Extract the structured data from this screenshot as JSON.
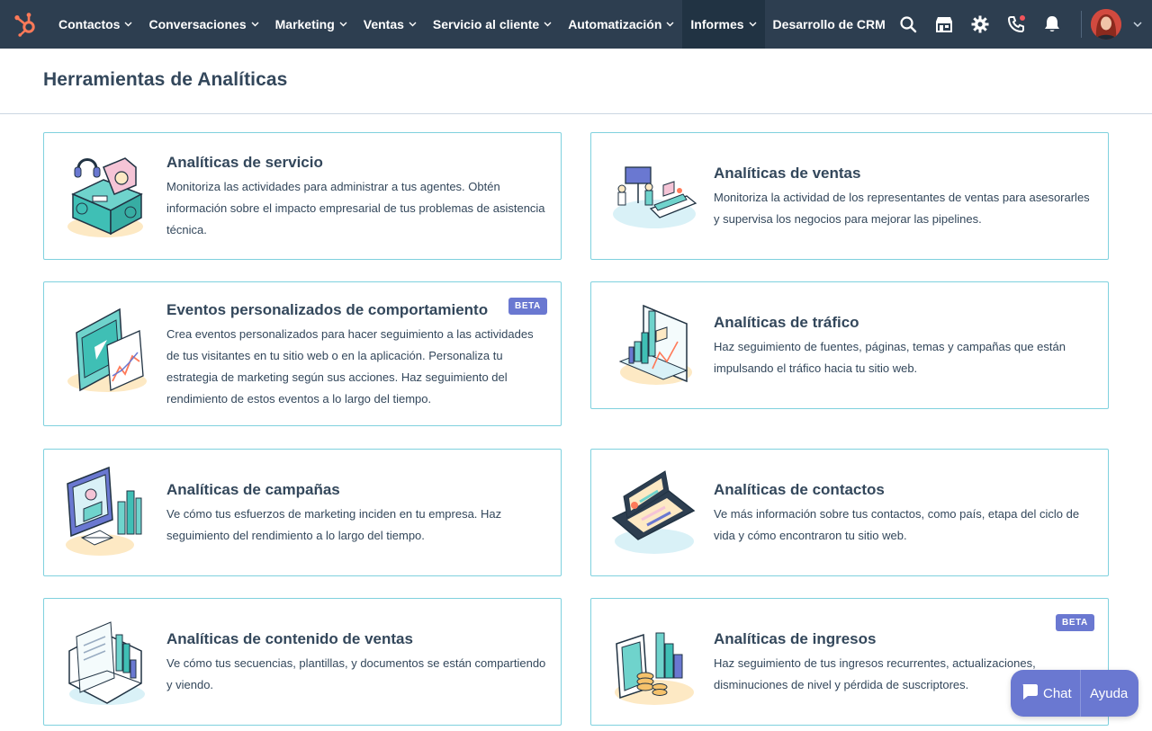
{
  "topnav": {
    "items": [
      {
        "label": "Contactos",
        "chevron": true,
        "active": false
      },
      {
        "label": "Conversaciones",
        "chevron": true,
        "active": false
      },
      {
        "label": "Marketing",
        "chevron": true,
        "active": false
      },
      {
        "label": "Ventas",
        "chevron": true,
        "active": false
      },
      {
        "label": "Servicio al cliente",
        "chevron": true,
        "active": false
      },
      {
        "label": "Automatización",
        "chevron": true,
        "active": false
      },
      {
        "label": "Informes",
        "chevron": true,
        "active": true
      },
      {
        "label": "Desarrollo de CRM",
        "chevron": false,
        "active": false
      }
    ],
    "icons": [
      "search-icon",
      "marketplace-icon",
      "settings-gear-icon",
      "calling-icon",
      "notifications-bell-icon"
    ],
    "colors": {
      "bg": "#2d3e50",
      "active_bg": "#213343",
      "brand_orange": "#ff7a59"
    }
  },
  "header": {
    "title": "Herramientas de Analíticas"
  },
  "cards": [
    {
      "title": "Analíticas de servicio",
      "description": "Monitoriza las actividades para administrar a tus agentes. Obtén información sobre el impacto empresarial de tus problemas de asistencia técnica.",
      "icon": "service-analytics-illustration"
    },
    {
      "title": "Analíticas de ventas",
      "description": "Monitoriza la actividad de los representantes de ventas para asesorarles y supervisa los negocios para mejorar las pipelines.",
      "icon": "sales-analytics-illustration"
    },
    {
      "title": "Eventos personalizados de comportamiento",
      "description": "Crea eventos personalizados para hacer seguimiento a las actividades de tus visitantes en tu sitio web o en la aplicación. Personaliza tu estrategia de marketing según sus acciones. Haz seguimiento del rendimiento de estos eventos a lo largo del tiempo.",
      "badge": "BETA",
      "icon": "custom-events-illustration"
    },
    {
      "title": "Analíticas de tráfico",
      "description": "Haz seguimiento de fuentes, páginas, temas y campañas que están impulsando el tráfico hacia tu sitio web.",
      "icon": "traffic-analytics-illustration"
    },
    {
      "title": "Analíticas de campañas",
      "description": "Ve cómo tus esfuerzos de marketing inciden en tu empresa. Haz seguimiento del rendimiento a lo largo del tiempo.",
      "icon": "campaign-analytics-illustration"
    },
    {
      "title": "Analíticas de contactos",
      "description": "Ve más información sobre tus contactos, como país, etapa del ciclo de vida y cómo encontraron tu sitio web.",
      "icon": "contact-analytics-illustration"
    },
    {
      "title": "Analíticas de contenido de ventas",
      "description": "Ve cómo tus secuencias, plantillas, y documentos se están compartiendo y viendo.",
      "icon": "sales-content-analytics-illustration"
    },
    {
      "title": "Analíticas de ingresos",
      "description": "Haz seguimiento de tus ingresos recurrentes, actualizaciones, disminuciones de nivel y pérdida de suscriptores.",
      "badge": "BETA",
      "icon": "revenue-analytics-illustration"
    }
  ],
  "chat_widget": {
    "chat_label": "Chat",
    "help_label": "Ayuda",
    "color": "#6a78d1"
  },
  "colors": {
    "card_border": "#7fd1de",
    "text": "#33475b",
    "beta": "#6a78d1"
  }
}
